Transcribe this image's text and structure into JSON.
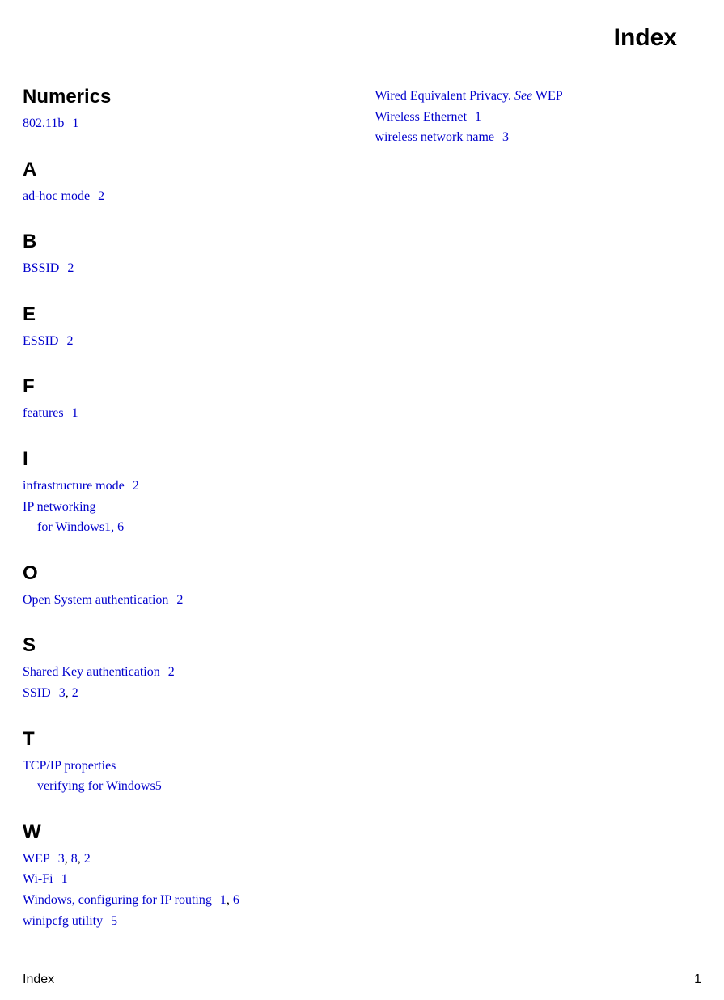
{
  "title": "Index",
  "footer": {
    "left": "Index",
    "right": "1"
  },
  "left_sections": [
    {
      "heading": "Numerics",
      "entries": [
        {
          "term": "802.11b",
          "pages": [
            "1"
          ]
        }
      ]
    },
    {
      "heading": "A",
      "entries": [
        {
          "term": "ad-hoc mode",
          "pages": [
            "2"
          ]
        }
      ]
    },
    {
      "heading": "B",
      "entries": [
        {
          "term": "BSSID",
          "pages": [
            "2"
          ]
        }
      ]
    },
    {
      "heading": "E",
      "entries": [
        {
          "term": "ESSID",
          "pages": [
            "2"
          ]
        }
      ]
    },
    {
      "heading": "F",
      "entries": [
        {
          "term": "features",
          "pages": [
            "1"
          ]
        }
      ]
    },
    {
      "heading": "I",
      "entries": [
        {
          "term": "infrastructure mode",
          "pages": [
            "2"
          ]
        },
        {
          "term": "IP networking",
          "sub": {
            "term": "for Windows",
            "pages": [
              "1",
              "6"
            ]
          }
        }
      ]
    },
    {
      "heading": "O",
      "entries": [
        {
          "term": "Open System authentication",
          "pages": [
            "2"
          ]
        }
      ]
    },
    {
      "heading": "S",
      "entries": [
        {
          "term": "Shared Key authentication",
          "pages": [
            "2"
          ]
        },
        {
          "term": "SSID",
          "pages": [
            "3",
            "2"
          ]
        }
      ]
    },
    {
      "heading": "T",
      "entries": [
        {
          "term": "TCP/IP properties",
          "sub": {
            "term": "verifying for Windows",
            "pages": [
              "5"
            ]
          }
        }
      ]
    },
    {
      "heading": "W",
      "entries": [
        {
          "term": "WEP",
          "pages": [
            "3",
            "8",
            "2"
          ]
        },
        {
          "term": "Wi-Fi",
          "pages": [
            "1"
          ]
        },
        {
          "term": "Windows, configuring for IP routing",
          "pages": [
            "1",
            "6"
          ]
        },
        {
          "term": "winipcfg utility",
          "pages": [
            "5"
          ]
        }
      ]
    }
  ],
  "right_entries": [
    {
      "term": "Wired Equivalent Privacy.",
      "see": "See",
      "see_target": "WEP"
    },
    {
      "term": "Wireless Ethernet",
      "pages": [
        "1"
      ]
    },
    {
      "term": "wireless network name",
      "pages": [
        "3"
      ]
    }
  ]
}
